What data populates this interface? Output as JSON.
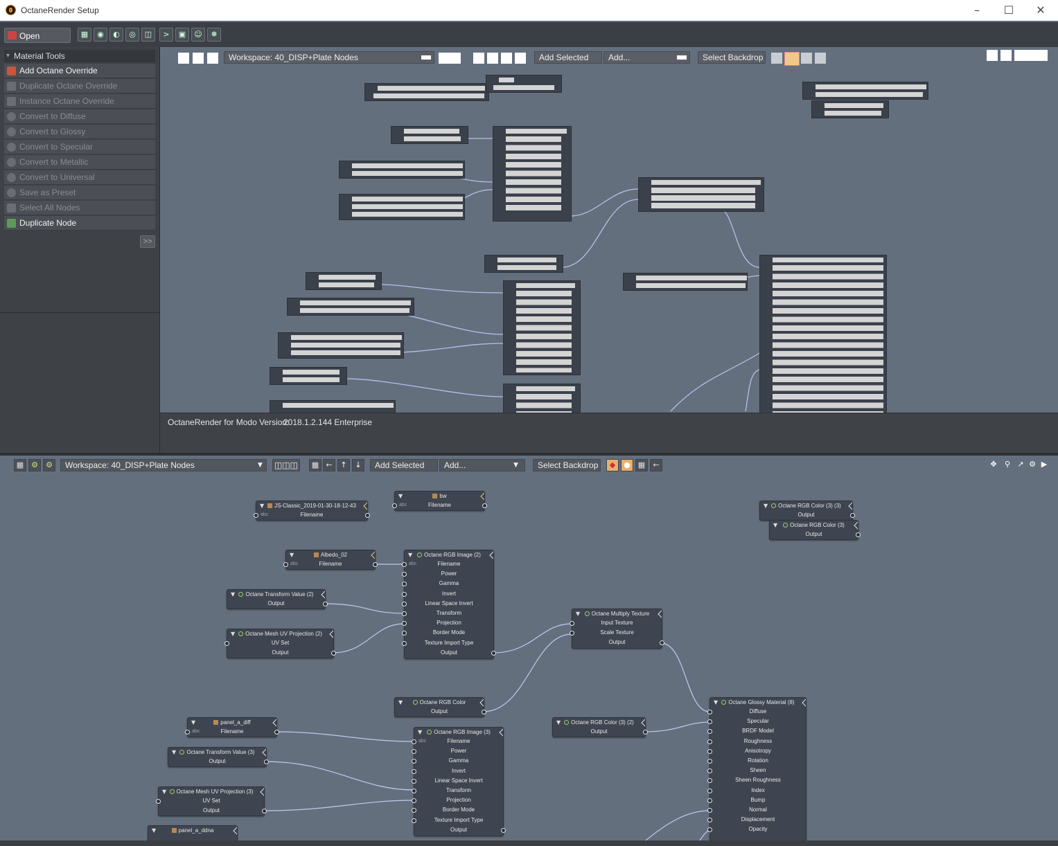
{
  "window": {
    "title": "OctaneRender Setup",
    "controls": [
      "minimize",
      "maximize",
      "close"
    ]
  },
  "toolbar": {
    "open_viewport": "Open Viewport"
  },
  "material_tools": {
    "header": "Material Tools",
    "items": [
      {
        "label": "Add Octane Override",
        "enabled": true
      },
      {
        "label": "Duplicate Octane Override",
        "enabled": false
      },
      {
        "label": "Instance Octane Override",
        "enabled": false
      },
      {
        "label": "Convert to Diffuse",
        "enabled": false
      },
      {
        "label": "Convert to Glossy",
        "enabled": false
      },
      {
        "label": "Convert to Specular",
        "enabled": false
      },
      {
        "label": "Convert to Metallic",
        "enabled": false
      },
      {
        "label": "Convert to Universal",
        "enabled": false
      },
      {
        "label": "Save as Preset",
        "enabled": false
      },
      {
        "label": "Select All Nodes",
        "enabled": false
      },
      {
        "label": "Duplicate Node",
        "enabled": true
      }
    ],
    "expand": ">>"
  },
  "top_view": {
    "workspace": "Workspace: 40_DISP+Plate Nodes",
    "add_selected": "Add Selected",
    "add": "Add...",
    "select_backdrop": "Select Backdrop"
  },
  "info": {
    "label": "OctaneRender for Modo Version:",
    "value": "2018.1.2.144 Enterprise"
  },
  "bottom_view": {
    "workspace": "Workspace: 40_DISP+Plate Nodes",
    "add_selected": "Add Selected",
    "add": "Add...",
    "select_backdrop": "Select Backdrop"
  },
  "nodes": {
    "n1": {
      "title": "JS-Classic_2019-01-30-18-12-43",
      "rows": [
        "Filename"
      ]
    },
    "n2": {
      "title": "bw",
      "rows": [
        "Filename"
      ]
    },
    "n3": {
      "title": "Octane RGB Color (3) (3)",
      "rows": [
        "Output"
      ]
    },
    "n4": {
      "title": "Octane RGB Color (3)",
      "rows": [
        "Output"
      ]
    },
    "n5": {
      "title": "Albedo_02",
      "rows": [
        "Filename"
      ]
    },
    "n6": {
      "title": "Octane RGB Image (2)",
      "rows": [
        "Filename",
        "Power",
        "Gamma",
        "Invert",
        "Linear Space Invert",
        "Transform",
        "Projection",
        "Border Mode",
        "Texture Import Type",
        "Output"
      ]
    },
    "n7": {
      "title": "Octane Transform Value (2)",
      "rows": [
        "Output"
      ]
    },
    "n8": {
      "title": "Octane Mesh UV Projection (2)",
      "rows": [
        "UV Set",
        "Output"
      ]
    },
    "n9": {
      "title": "Octane Multiply Texture",
      "rows": [
        "Input Texture",
        "Scale Texture",
        "Output"
      ]
    },
    "n10": {
      "title": "Octane RGB Color",
      "rows": [
        "Output"
      ]
    },
    "n11": {
      "title": "panel_a_diff",
      "rows": [
        "Filename"
      ]
    },
    "n12": {
      "title": "Octane Transform Value (3)",
      "rows": [
        "Output"
      ]
    },
    "n13": {
      "title": "Octane RGB Image (3)",
      "rows": [
        "Filename",
        "Power",
        "Gamma",
        "Invert",
        "Linear Space Invert",
        "Transform",
        "Projection",
        "Border Mode",
        "Texture Import Type",
        "Output"
      ]
    },
    "n14": {
      "title": "Octane RGB Color (3) (2)",
      "rows": [
        "Output"
      ]
    },
    "n15": {
      "title": "Octane Glossy Material (8)",
      "rows": [
        "Diffuse",
        "Specular",
        "BRDF Model",
        "Roughness",
        "Anisotropy",
        "Rotation",
        "Sheen",
        "Sheen Roughness",
        "Index",
        "Bump",
        "Normal",
        "Displacement",
        "Opacity"
      ]
    },
    "n16": {
      "title": "Octane Mesh UV Projection (3)",
      "rows": [
        "UV Set",
        "Output"
      ]
    },
    "n17": {
      "title": "panel_a_ddna",
      "rows": []
    }
  }
}
